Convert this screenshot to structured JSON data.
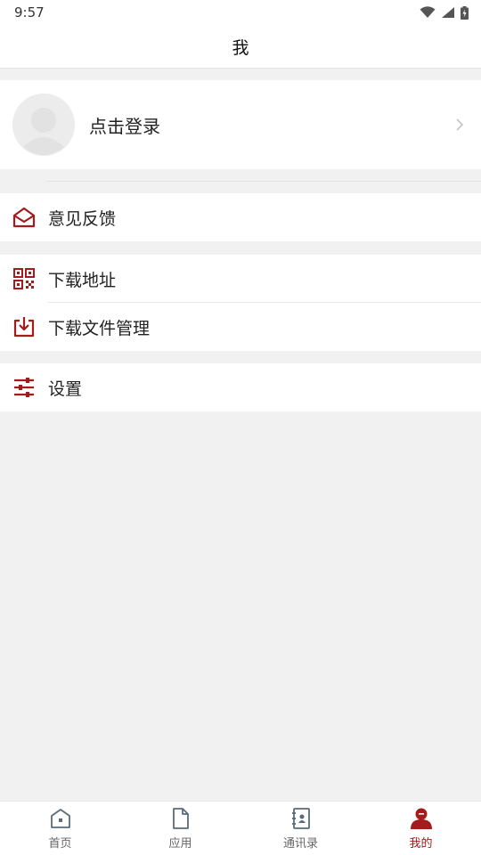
{
  "status_bar": {
    "time": "9:57"
  },
  "header": {
    "title": "我"
  },
  "profile": {
    "login_label": "点击登录"
  },
  "menu": {
    "feedback": "意见反馈",
    "download_address": "下载地址",
    "download_manager": "下载文件管理",
    "settings": "设置"
  },
  "tabs": [
    {
      "label": "首页",
      "icon": "home-icon"
    },
    {
      "label": "应用",
      "icon": "file-icon"
    },
    {
      "label": "通讯录",
      "icon": "contacts-icon"
    },
    {
      "label": "我的",
      "icon": "user-icon",
      "active": true
    }
  ],
  "colors": {
    "accent": "#a31b1b",
    "tab_inactive": "#5b6b7a",
    "background": "#f1f1f1"
  }
}
